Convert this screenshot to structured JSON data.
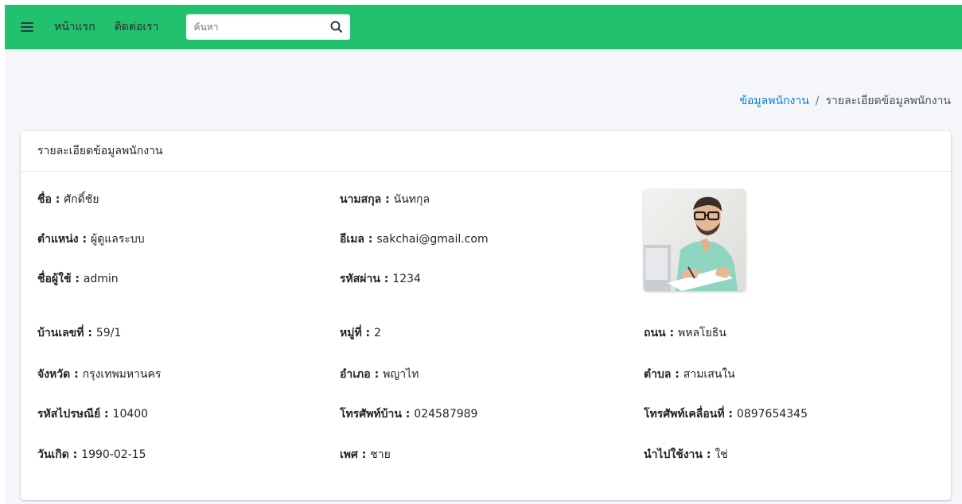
{
  "nav": {
    "home": "หน้าแรก",
    "contact": "ติดต่อเรา",
    "search_placeholder": "ค้นหา",
    "brand_color": "#22c16e"
  },
  "breadcrumb": {
    "parent": "ข้อมูลพนักงาน",
    "separator": "/",
    "current": "รายละเอียดข้อมูลพนักงาน"
  },
  "card": {
    "title": "รายละเอียดข้อมูลพนักงาน",
    "fields": {
      "first_name": {
        "label": "ชื่อ",
        "value": "ศักดิ์ชัย"
      },
      "last_name": {
        "label": "นามสกุล",
        "value": "นันทกุล"
      },
      "position": {
        "label": "ตำแหน่ง",
        "value": "ผู้ดูแลระบบ"
      },
      "email": {
        "label": "อีเมล",
        "value": "sakchai@gmail.com"
      },
      "username": {
        "label": "ชื่อผู้ใช้",
        "value": "admin"
      },
      "password": {
        "label": "รหัสผ่าน",
        "value": "1234"
      },
      "house_no": {
        "label": "บ้านเลขที่",
        "value": "59/1"
      },
      "moo": {
        "label": "หมู่ที่",
        "value": "2"
      },
      "road": {
        "label": "ถนน",
        "value": "พหลโยธิน"
      },
      "province": {
        "label": "จังหวัด",
        "value": "กรุงเทพมหานคร"
      },
      "district": {
        "label": "อำเภอ",
        "value": "พญาไท"
      },
      "subdistrict": {
        "label": "ตำบล",
        "value": "สามเสนใน"
      },
      "postcode": {
        "label": "รหัสไปรษณีย์",
        "value": "10400"
      },
      "home_phone": {
        "label": "โทรศัพท์บ้าน",
        "value": "024587989"
      },
      "mobile": {
        "label": "โทรศัพท์เคลื่อนที่",
        "value": "0897654345"
      },
      "birthdate": {
        "label": "วันเกิด",
        "value": "1990-02-15"
      },
      "gender": {
        "label": "เพศ",
        "value": "ชาย"
      },
      "active": {
        "label": "นำไปใช้งาน",
        "value": "ใช่"
      }
    },
    "colon": " : "
  }
}
